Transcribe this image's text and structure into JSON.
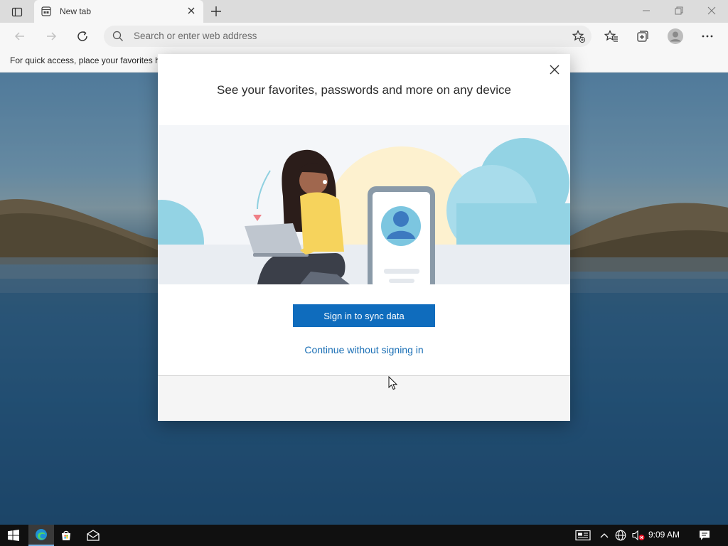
{
  "browser": {
    "tab": {
      "title": "New tab"
    },
    "address_bar": {
      "placeholder": "Search or enter web address"
    },
    "favorites_bar": {
      "text": "For quick access, place your favorites h"
    }
  },
  "dialog": {
    "title": "See your favorites, passwords and more on any device",
    "sign_in_label": "Sign in to sync data",
    "continue_label": "Continue without signing in"
  },
  "taskbar": {
    "time": "9:09 AM"
  },
  "colors": {
    "accent": "#0f6cbd",
    "link": "#1a6fb5"
  }
}
